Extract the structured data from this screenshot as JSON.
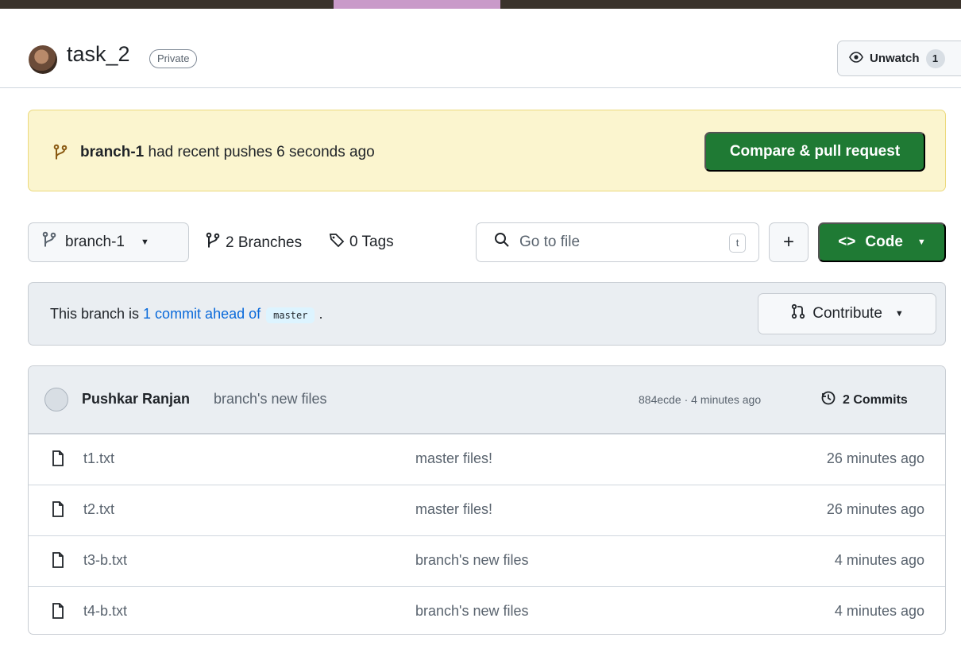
{
  "repo": {
    "name": "task_2",
    "visibility": "Private",
    "unwatch_label": "Unwatch",
    "unwatch_count": "1"
  },
  "push_banner": {
    "branch": "branch-1",
    "message": " had recent pushes 6 seconds ago",
    "button_label": "Compare & pull request"
  },
  "toolbar": {
    "current_branch": "branch-1",
    "branches_label": "2 Branches",
    "tags_label": "0 Tags",
    "search_placeholder": "Go to file",
    "search_shortcut": "t",
    "add_label": "+",
    "code_label": "Code"
  },
  "ahead": {
    "prefix": "This branch is ",
    "link_text": "1 commit ahead of",
    "branch": "master",
    "suffix": " ."
  },
  "contribute_label": "Contribute",
  "latest_commit": {
    "author": "Pushkar Ranjan",
    "message": "branch's new files",
    "meta": "884ecde · 4 minutes ago",
    "commits_label": "2 Commits"
  },
  "files": [
    {
      "name": "t1.txt",
      "message": "master files!",
      "time": "26 minutes ago"
    },
    {
      "name": "t2.txt",
      "message": "master files!",
      "time": "26 minutes ago"
    },
    {
      "name": "t3-b.txt",
      "message": "branch's new files",
      "time": "4 minutes ago"
    },
    {
      "name": "t4-b.txt",
      "message": "branch's new files",
      "time": "4 minutes ago"
    }
  ],
  "colors": {
    "primary_button": "#1f7a34",
    "banner_background": "#fbf5cf",
    "link": "#0969da"
  }
}
